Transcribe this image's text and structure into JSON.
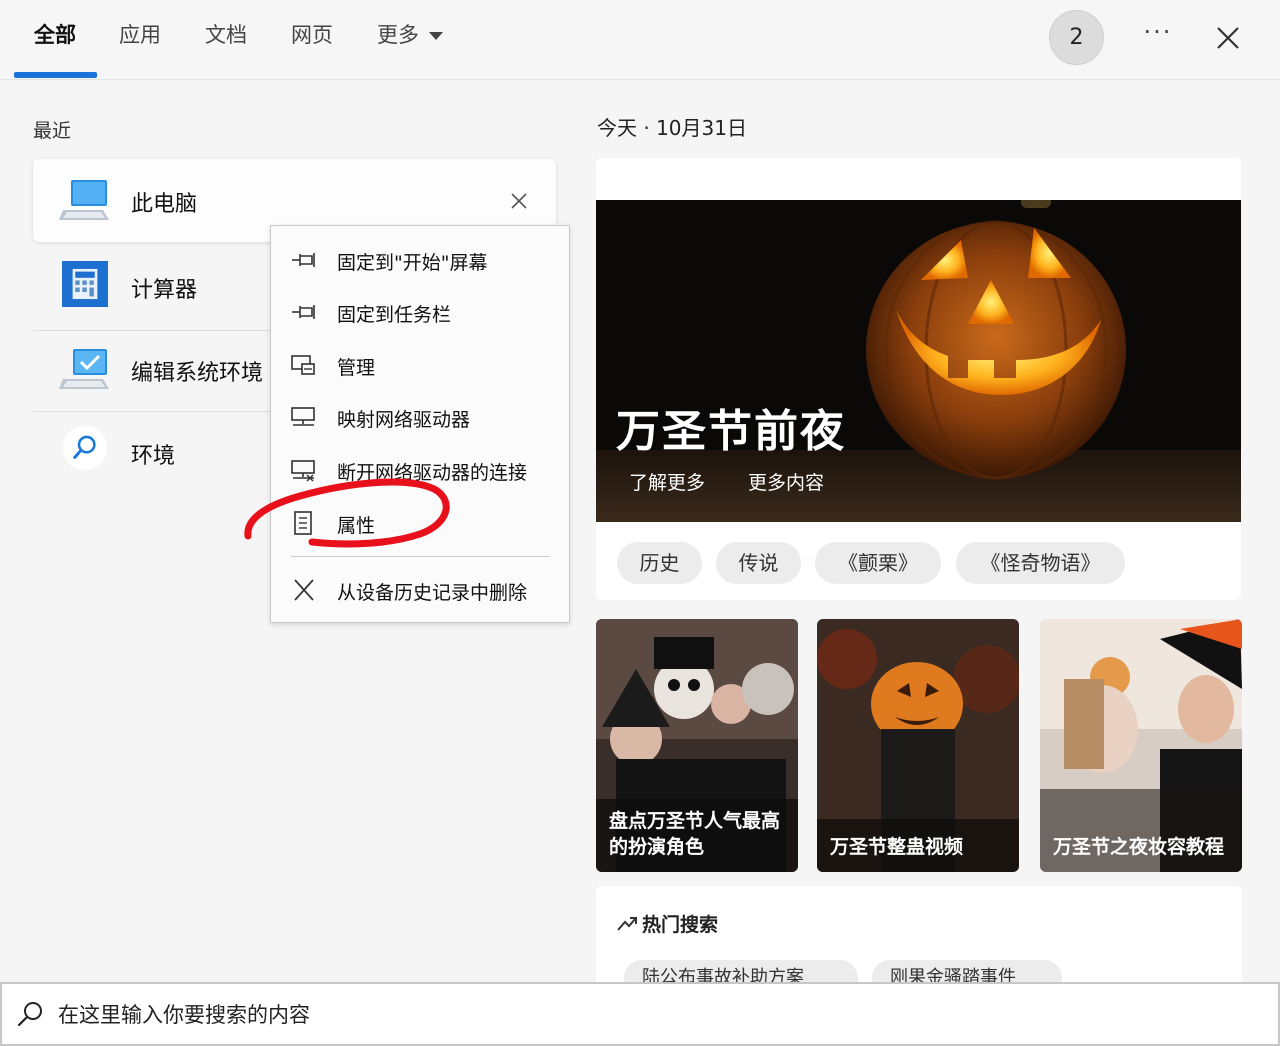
{
  "tabs": [
    {
      "label": "全部"
    },
    {
      "label": "应用"
    },
    {
      "label": "文档"
    },
    {
      "label": "网页"
    },
    {
      "label": "更多"
    }
  ],
  "header": {
    "badge": "2",
    "more": "···"
  },
  "recent": {
    "label": "最近",
    "items": [
      {
        "label": "此电脑",
        "icon": "computer-icon"
      },
      {
        "label": "计算器",
        "icon": "calculator-icon"
      },
      {
        "label": "编辑系统环境",
        "icon": "system-settings-icon"
      },
      {
        "label": "环境",
        "icon": "search-icon"
      }
    ]
  },
  "context_menu": {
    "items": [
      {
        "label": "固定到\"开始\"屏幕",
        "icon": "pin-icon"
      },
      {
        "label": "固定到任务栏",
        "icon": "pin-icon"
      },
      {
        "label": "管理",
        "icon": "manage-icon"
      },
      {
        "label": "映射网络驱动器",
        "icon": "network-drive-icon"
      },
      {
        "label": "断开网络驱动器的连接",
        "icon": "network-disconnect-icon"
      },
      {
        "label": "属性",
        "icon": "properties-icon"
      },
      {
        "label": "从设备历史记录中删除",
        "icon": "close-icon"
      }
    ]
  },
  "today": {
    "date": "今天 · 10月31日",
    "hero": {
      "title": "万圣节前夜",
      "link1": "了解更多",
      "link2": "更多内容"
    },
    "chips": [
      "历史",
      "传说",
      "《颤栗》",
      "《怪奇物语》"
    ],
    "news": [
      {
        "title": "盘点万圣节人气最高的扮演角色"
      },
      {
        "title": "万圣节整蛊视频"
      },
      {
        "title": "万圣节之夜妆容教程"
      }
    ]
  },
  "trending": {
    "title": "热门搜索",
    "items": [
      "陆公布事故补助方案",
      "刚果金骚踏事件"
    ]
  },
  "search": {
    "placeholder": "在这里输入你要搜索的内容"
  }
}
